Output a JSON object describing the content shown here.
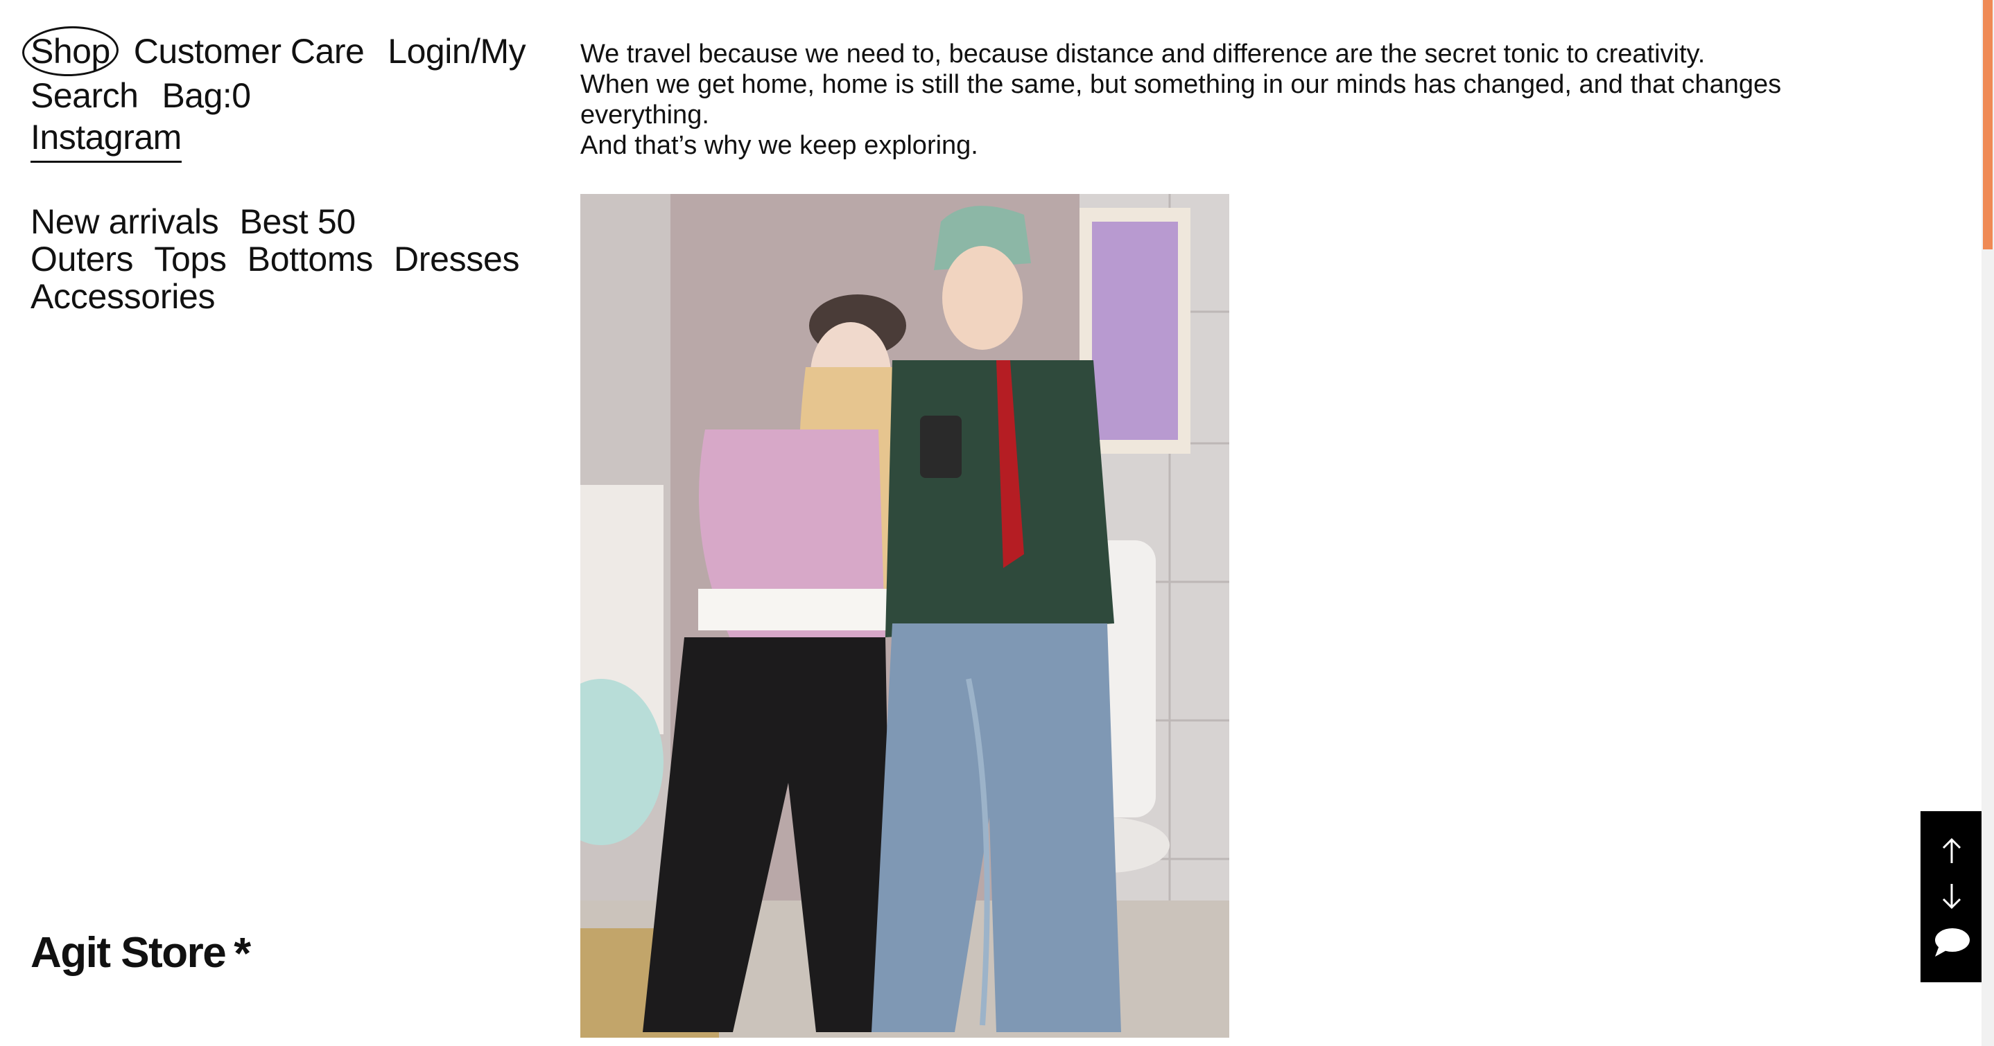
{
  "top_nav": {
    "shop": "Shop",
    "customer_care": "Customer Care",
    "login": "Login/My",
    "search": "Search",
    "bag": "Bag:0",
    "instagram": "Instagram"
  },
  "categories": {
    "new_arrivals": "New arrivals",
    "best": "Best 50",
    "outers": "Outers",
    "tops": "Tops",
    "bottoms": "Bottoms",
    "dresses": "Dresses",
    "accessories": "Accessories"
  },
  "brand": {
    "name": "Agit Store",
    "mark": "*"
  },
  "quote": {
    "line1": "We travel because we need to, because distance and difference are the secret tonic to creativity.",
    "line2": "When we get home, home is still the same, but something in our minds has changed, and that changes everything.",
    "line3": "And that’s why we keep exploring."
  },
  "controls": {
    "up": "arrow-up-icon",
    "down": "arrow-down-icon",
    "chat": "chat-bubble-icon"
  },
  "colors": {
    "scroll_accent": "#ef8a55",
    "controls_bg": "#000000"
  }
}
